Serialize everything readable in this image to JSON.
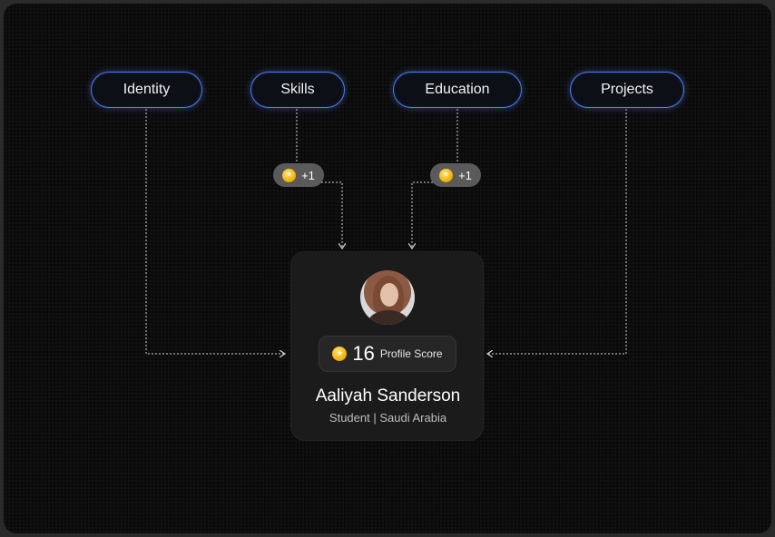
{
  "nodes": [
    {
      "label": "Identity"
    },
    {
      "label": "Skills"
    },
    {
      "label": "Education"
    },
    {
      "label": "Projects"
    }
  ],
  "badges": [
    {
      "label": "+1"
    },
    {
      "label": "+1"
    }
  ],
  "profile": {
    "score": "16",
    "score_label": "Profile Score",
    "name": "Aaliyah Sanderson",
    "subtitle": "Student | Saudi Arabia"
  },
  "colors": {
    "accent": "#4f7ef0",
    "coin": "#f5b50a",
    "card": "#1b1b1b"
  }
}
